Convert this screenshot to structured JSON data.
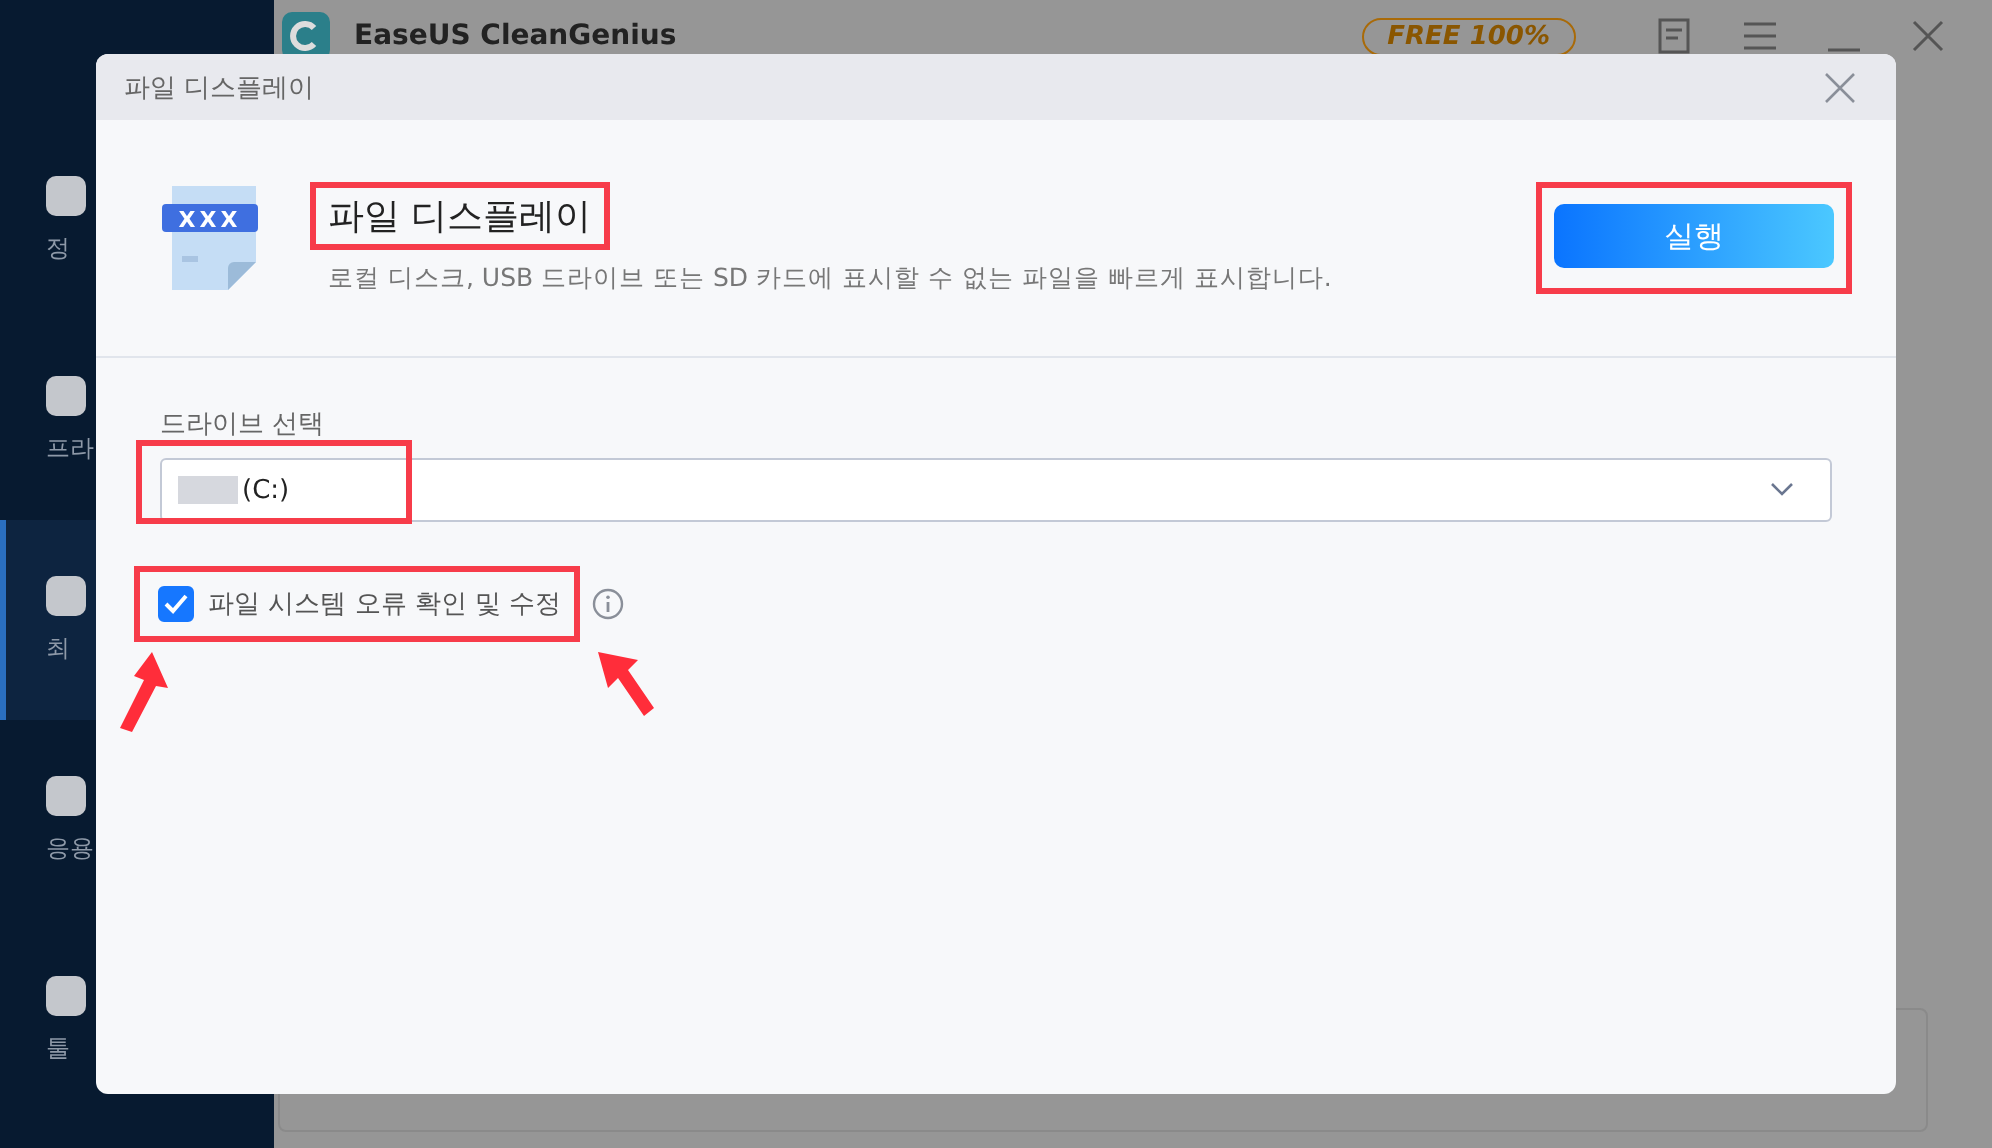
{
  "app": {
    "title": "EaseUS CleanGenius",
    "badge": "FREE 100%"
  },
  "sidebar": {
    "items": [
      {
        "label": "정",
        "selected": false
      },
      {
        "label": "프라",
        "selected": false
      },
      {
        "label": "최",
        "selected": true
      },
      {
        "label": "응용",
        "selected": false
      },
      {
        "label": "툴",
        "selected": false
      }
    ]
  },
  "dialog": {
    "title": "파일 디스플레이",
    "header": {
      "icon_text": "XXX",
      "title": "파일 디스플레이",
      "title_highlighted": true,
      "description": "로컬 디스크, USB 드라이브 또는 SD 카드에 표시할 수 없는 파일을 빠르게 표시합니다.",
      "button": "실행",
      "button_highlighted": true
    },
    "drive": {
      "label": "드라이브 선택",
      "value": "(C:)",
      "highlighted": true
    },
    "option": {
      "label": "파일 시스템 오류 확인 및 수정",
      "checked": true,
      "highlighted": true,
      "arrows": true
    }
  }
}
